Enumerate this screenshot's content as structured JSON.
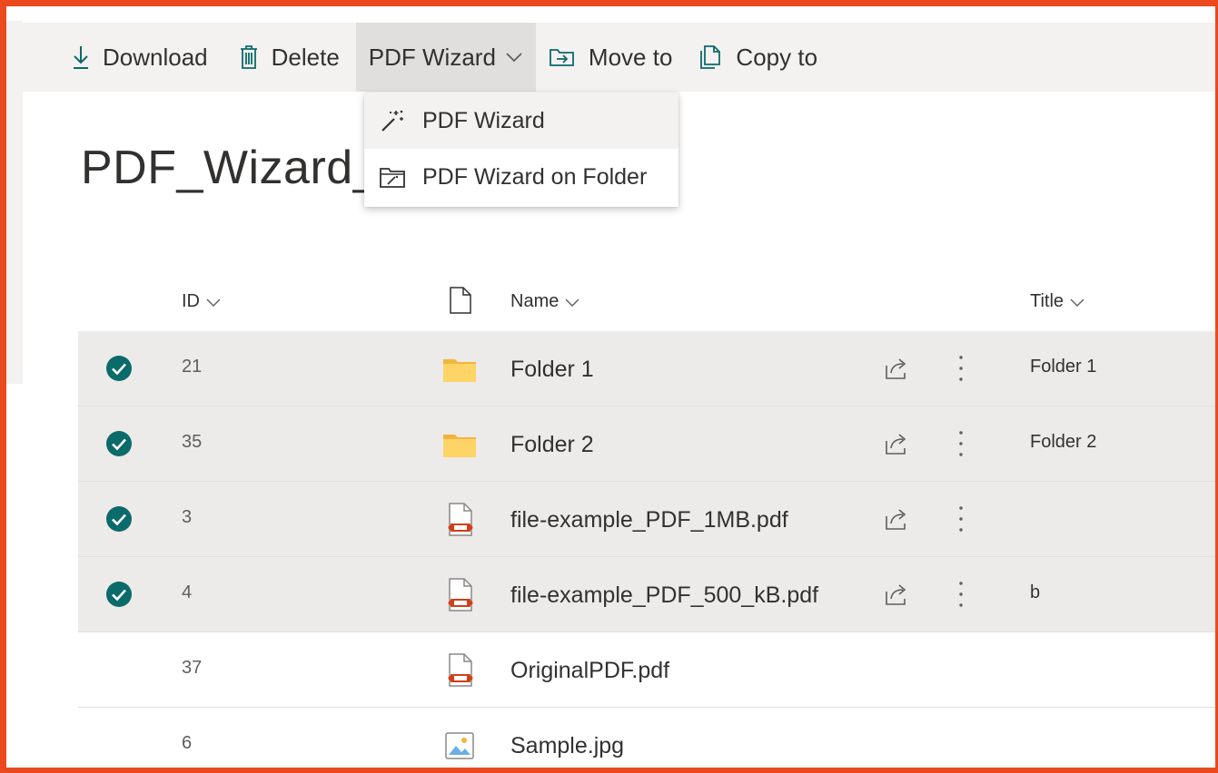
{
  "toolbar": {
    "download_label": "Download",
    "delete_label": "Delete",
    "pdf_wizard_label": "PDF Wizard",
    "move_to_label": "Move to",
    "copy_to_label": "Copy to"
  },
  "dropdown": {
    "items": [
      {
        "label": "PDF Wizard",
        "icon": "magic-wand-icon"
      },
      {
        "label": "PDF Wizard on Folder",
        "icon": "folder-wand-icon"
      }
    ]
  },
  "page": {
    "title": "PDF_Wizard_T"
  },
  "table": {
    "headers": {
      "id": "ID",
      "name": "Name",
      "title": "Title"
    },
    "rows": [
      {
        "id": "21",
        "name": "Folder 1",
        "title": "Folder 1",
        "type": "folder",
        "selected": true
      },
      {
        "id": "35",
        "name": "Folder 2",
        "title": "Folder 2",
        "type": "folder",
        "selected": true
      },
      {
        "id": "3",
        "name": "file-example_PDF_1MB.pdf",
        "title": "",
        "type": "pdf",
        "selected": true
      },
      {
        "id": "4",
        "name": "file-example_PDF_500_kB.pdf",
        "title": "b",
        "type": "pdf",
        "selected": true
      },
      {
        "id": "37",
        "name": "OriginalPDF.pdf",
        "title": "",
        "type": "pdf",
        "selected": false
      },
      {
        "id": "6",
        "name": "Sample.jpg",
        "title": "",
        "type": "image",
        "selected": false
      }
    ]
  },
  "colors": {
    "accent_check": "#0b6a6a",
    "folder": "#f8c640",
    "pdf": "#d13f19",
    "border": "#ea4a1e"
  }
}
